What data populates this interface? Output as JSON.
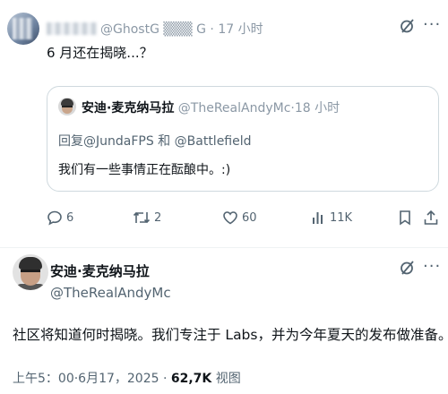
{
  "reply": {
    "handle_visible": "@GhostG",
    "handle_tail": "G",
    "time": "17 小时",
    "text": "6 月还在揭晓...？"
  },
  "quote": {
    "name": "安迪·麦克纳马拉",
    "handle": "@TheRealAndyMc",
    "time": "18 小时",
    "reply_prefix": "回复",
    "mention1": "@JundaFPS",
    "joiner": " 和 ",
    "mention2": "@Battlefield",
    "text": "我们有一些事情正在酝酿中。:)"
  },
  "actions": {
    "replies": "6",
    "retweets": "2",
    "likes": "60",
    "views": "11K"
  },
  "icons": [
    "grok-icon",
    "more-icon",
    "reply-icon",
    "retweet-icon",
    "like-icon",
    "views-icon",
    "bookmark-icon",
    "share-icon"
  ],
  "main": {
    "name": "安迪·麦克纳马拉",
    "handle": "@TheRealAndyMc",
    "text": "社区将知道何时揭晓。我们专注于 Labs，并为今年夏天的发布做准备。:)",
    "timestamp": "上午5：00·6月17，2025 · ",
    "views_count": "62,7K",
    "views_label": " 视图"
  },
  "colors": {
    "text": "#0f1419",
    "secondary": "#536471",
    "border": "#cfd9de"
  }
}
